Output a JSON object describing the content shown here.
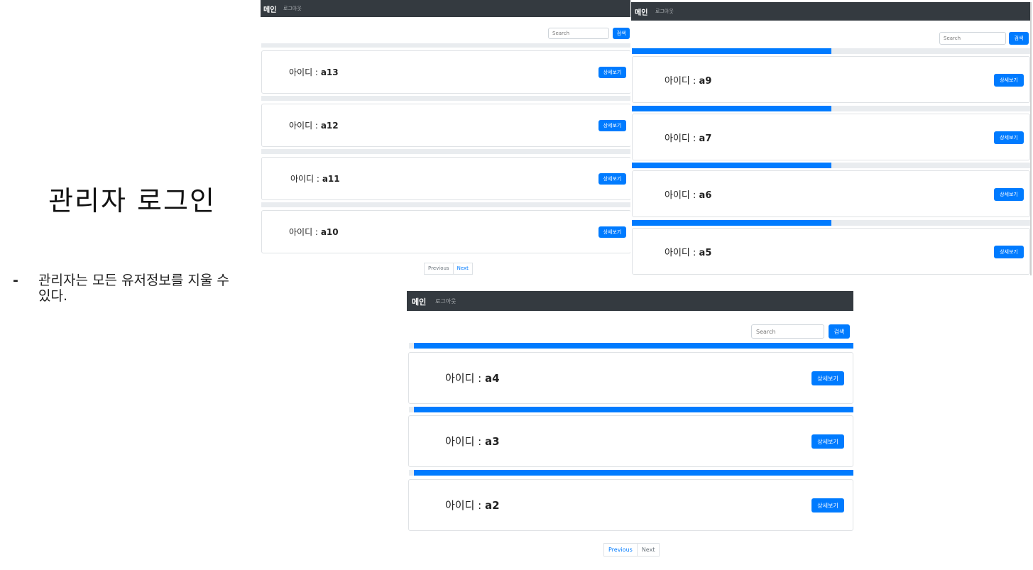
{
  "slide": {
    "title": "관리자 로그인",
    "bullet_dash": "-",
    "bullet_text": "관리자는 모든 유저정보를 지울 수 있다."
  },
  "screen_a": {
    "nav": {
      "brand": "메인",
      "logout": "로그아웃"
    },
    "search": {
      "placeholder": "Search",
      "button": "검색"
    },
    "cards": [
      {
        "label": "아이디 :",
        "id": "a13",
        "detail_button": "상세보기",
        "progress": 0.0
      },
      {
        "label": "아이디 :",
        "id": "a12",
        "detail_button": "상세보기",
        "progress": 0.0
      },
      {
        "label": "아이디 :",
        "id": "a11",
        "detail_button": "상세보기",
        "progress": 0.0
      },
      {
        "label": "아이디 :",
        "id": "a10",
        "detail_button": "상세보기",
        "progress": 0.0
      }
    ],
    "pagination": {
      "previous": "Previous",
      "next": "Next"
    }
  },
  "screen_b": {
    "nav": {
      "brand": "메인",
      "logout": "로그아웃"
    },
    "search": {
      "placeholder": "Search",
      "button": "검색"
    },
    "cards": [
      {
        "label": "아이디 :",
        "id": "a9",
        "detail_button": "상세보기",
        "progress": 0.5
      },
      {
        "label": "아이디 :",
        "id": "a7",
        "detail_button": "상세보기",
        "progress": 0.5
      },
      {
        "label": "아이디 :",
        "id": "a6",
        "detail_button": "상세보기",
        "progress": 0.5
      },
      {
        "label": "아이디 :",
        "id": "a5",
        "detail_button": "상세보기",
        "progress": 0.5
      }
    ]
  },
  "screen_c": {
    "nav": {
      "brand": "메인",
      "logout": "로그아웃"
    },
    "search": {
      "placeholder": "Search",
      "button": "검색"
    },
    "cards": [
      {
        "label": "아이디 :",
        "id": "a4",
        "detail_button": "상세보기",
        "progress": 1.0
      },
      {
        "label": "아이디 :",
        "id": "a3",
        "detail_button": "상세보기",
        "progress": 1.0
      },
      {
        "label": "아이디 :",
        "id": "a2",
        "detail_button": "상세보기",
        "progress": 1.0
      }
    ],
    "pagination": {
      "previous": "Previous",
      "next": "Next"
    }
  },
  "colors": {
    "navbar": "#343a40",
    "primary": "#007bff",
    "track": "#e9ecef"
  }
}
